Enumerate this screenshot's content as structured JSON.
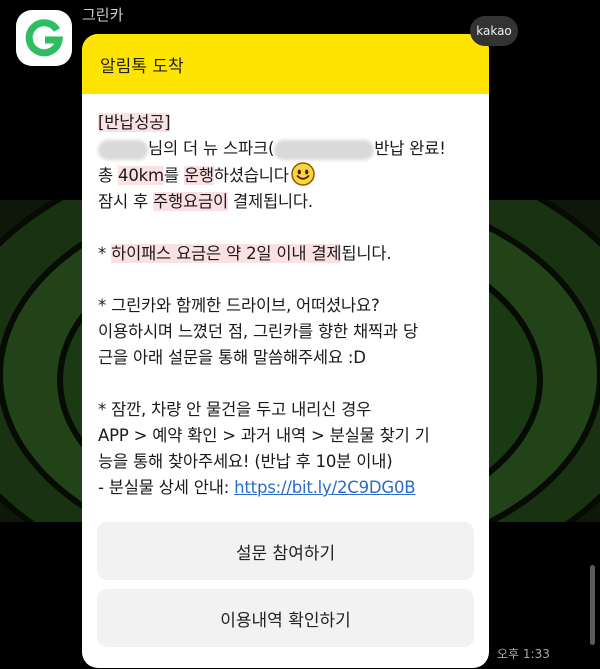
{
  "chat": {
    "sender_name": "그린카",
    "badge": "kakao",
    "timestamp": "오후 1:33"
  },
  "message": {
    "header": "알림톡 도착",
    "line_return_success": "[반납성공]",
    "line_car_prefix": "님의 더 뉴 스파크(",
    "line_car_suffix": "반납 완료!",
    "line_distance_pre": "총 ",
    "line_distance_value": "40km",
    "line_distance_mid": "를 ",
    "line_distance_hl": "운행",
    "line_distance_post": "하셨습니다",
    "line_payment_pre": "잠시 후 ",
    "line_payment_hl": "주행요금이",
    "line_payment_post": " 결제됩니다.",
    "line_hipass_pre": "* ",
    "line_hipass_hl": "하이패스 요금은 약 2일 이내 결제",
    "line_hipass_post": "됩니다.",
    "line_survey_1": "* 그린카와 함께한 드라이브, 어떠셨나요?",
    "line_survey_2": "이용하시며 느꼈던 점, 그린카를 향한 채찍과 당",
    "line_survey_3": "근을 아래 설문을 통해 말씀해주세요 :D",
    "line_lost_1": "* 잠깐, 차량 안 물건을 두고 내리신 경우",
    "line_lost_2": "APP > 예약 확인 > 과거 내역 > 분실물 찾기 기",
    "line_lost_3": "능을 통해 찾아주세요! (반납 후 10분 이내)",
    "line_lost_4_pre": "- 분실물 상세 안내: ",
    "line_lost_4_link": "https://bit.ly/2C9DG0B"
  },
  "buttons": {
    "survey": "설문 참여하기",
    "history": "이용내역 확인하기"
  },
  "colors": {
    "header_bg": "#fee500",
    "highlight": "#fbe1e4",
    "link": "#2a6cc7",
    "logo_green": "#2dbe60"
  },
  "icons": {
    "avatar": "greencar-logo-icon",
    "emoji": "smiling-face-emoji-icon"
  }
}
